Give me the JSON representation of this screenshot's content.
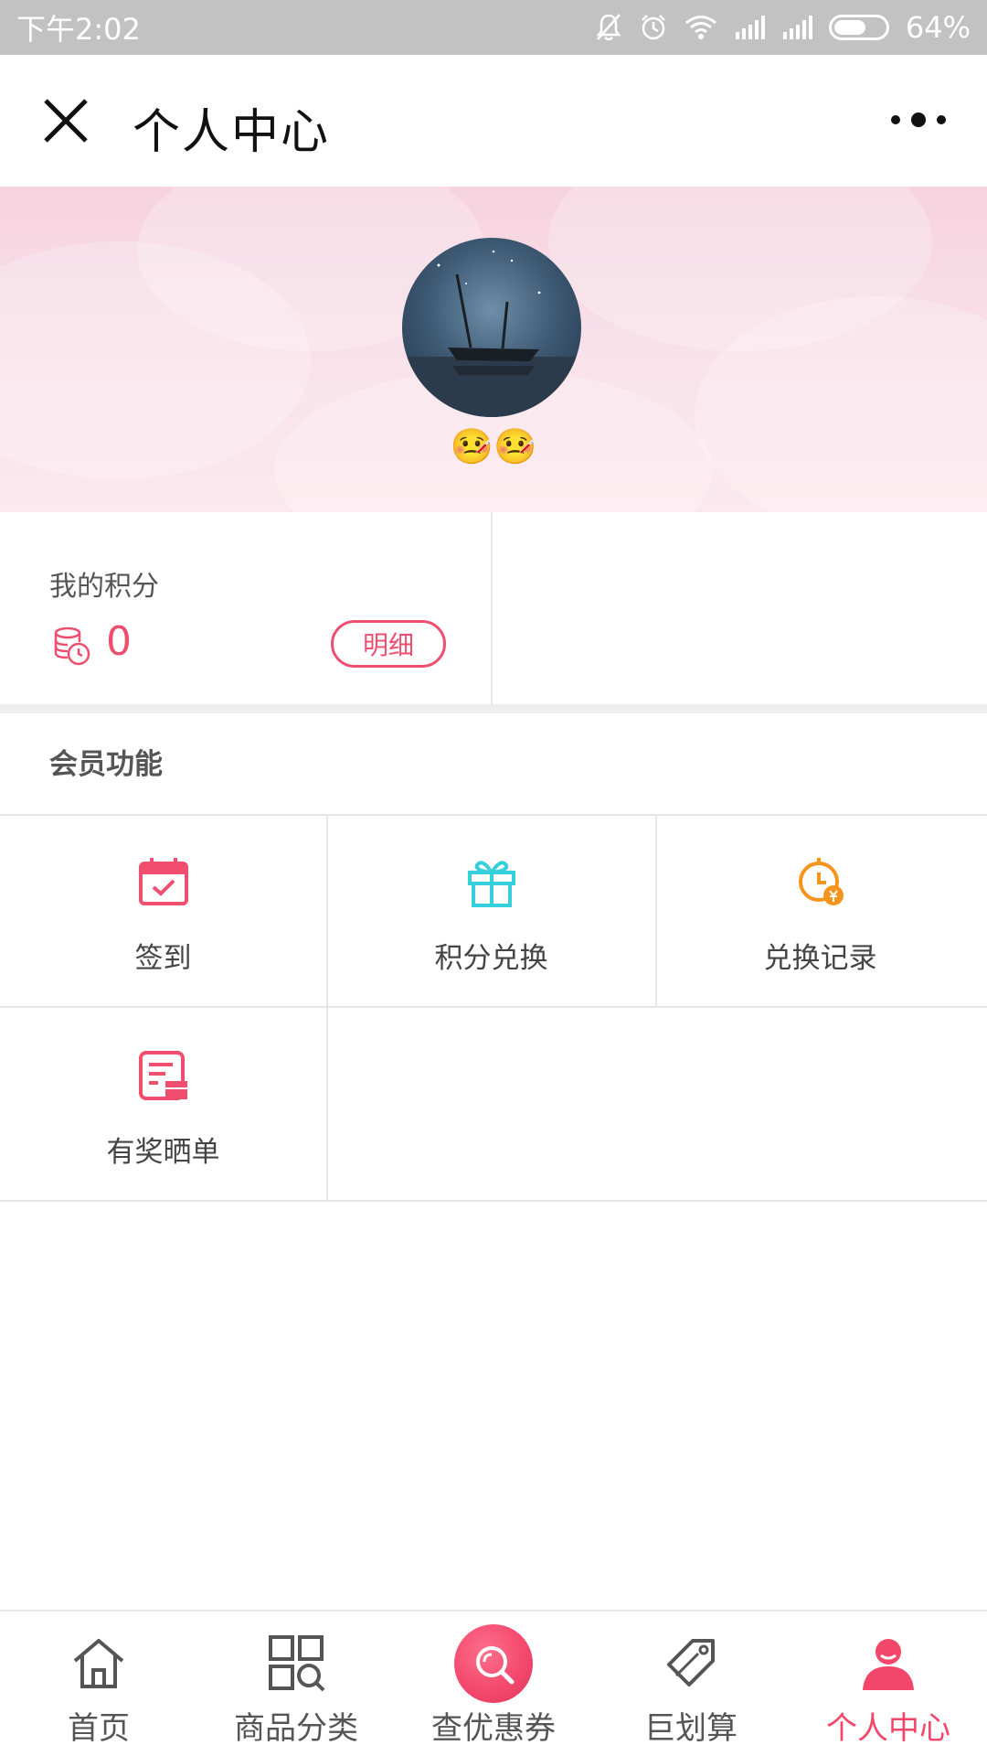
{
  "status_bar": {
    "time": "下午2:02",
    "battery": "64%"
  },
  "header": {
    "title": "个人中心"
  },
  "profile": {
    "nickname": "🤒🤒"
  },
  "points": {
    "label": "我的积分",
    "value": "0",
    "detail_button": "明细"
  },
  "member": {
    "title": "会员功能",
    "items": [
      {
        "label": "签到",
        "icon": "calendar-check-icon",
        "color": "#f04e6f"
      },
      {
        "label": "积分兑换",
        "icon": "gift-icon",
        "color": "#35d0dc"
      },
      {
        "label": "兑换记录",
        "icon": "clock-yen-icon",
        "color": "#f7941d"
      },
      {
        "label": "有奖晒单",
        "icon": "receipt-gift-icon",
        "color": "#f04e6f"
      }
    ]
  },
  "tabbar": {
    "items": [
      {
        "label": "首页",
        "icon": "home-icon"
      },
      {
        "label": "商品分类",
        "icon": "category-grid-icon"
      },
      {
        "label": "查优惠券",
        "icon": "search-coupon-icon"
      },
      {
        "label": "巨划算",
        "icon": "price-tag-icon"
      },
      {
        "label": "个人中心",
        "icon": "user-icon",
        "active": true
      }
    ],
    "active_color": "#f2466a"
  }
}
